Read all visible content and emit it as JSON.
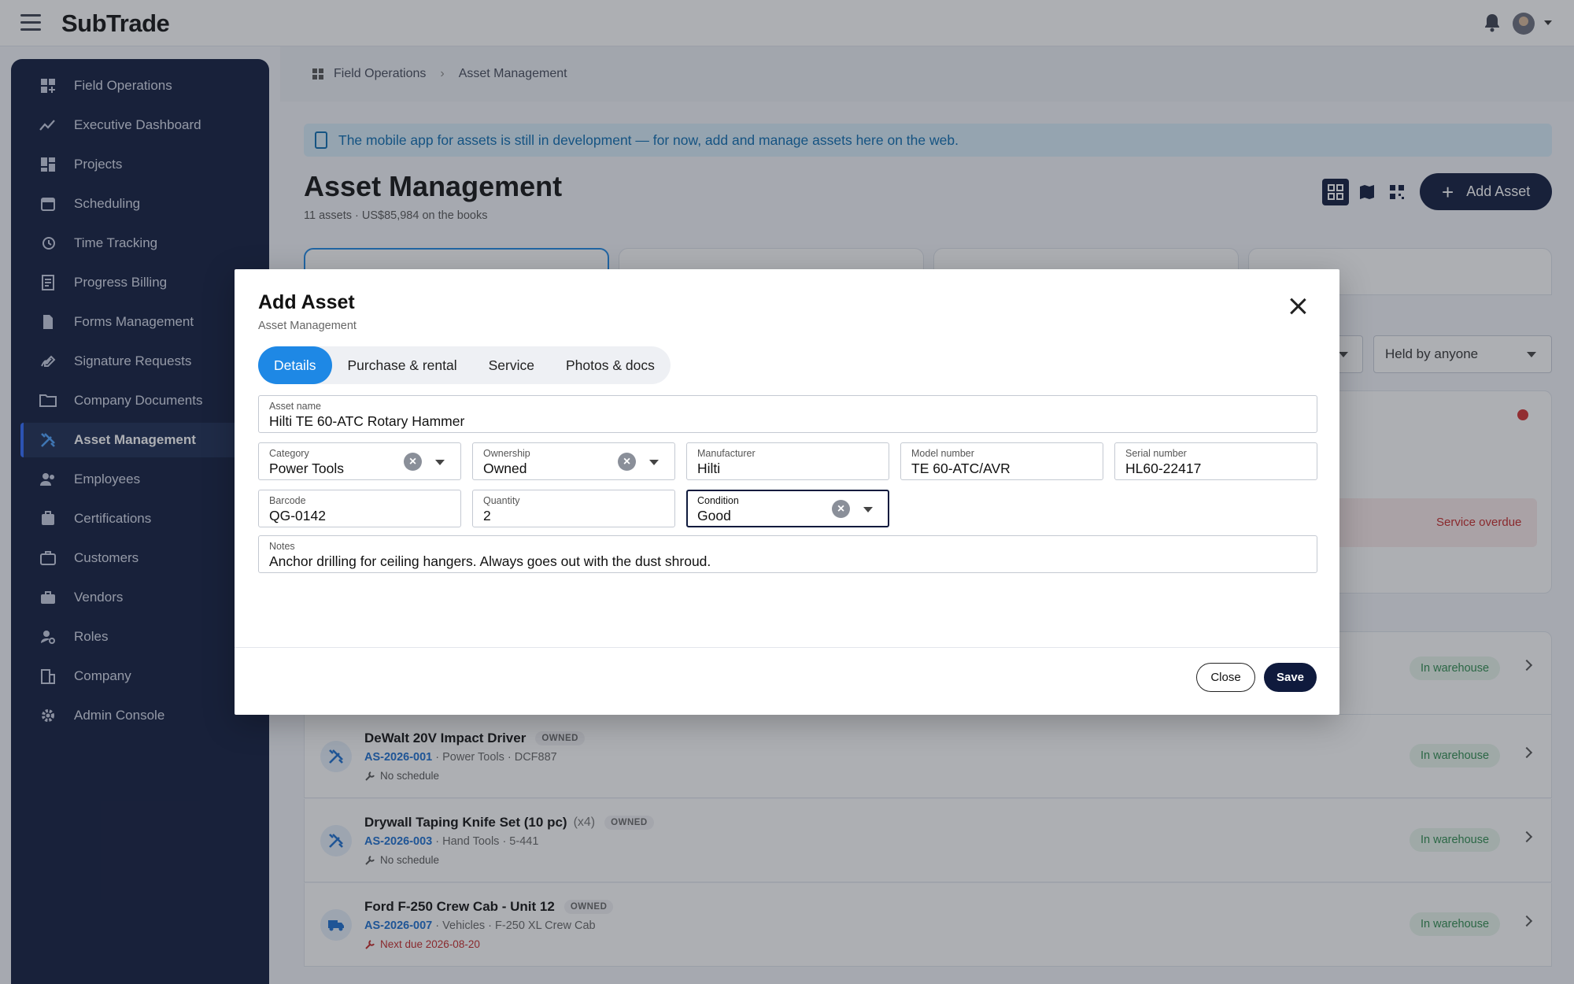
{
  "app": {
    "logo": "SubTrade"
  },
  "sidebar": {
    "items": [
      {
        "label": "Field Operations",
        "icon": "grid-plus-icon"
      },
      {
        "label": "Executive Dashboard",
        "icon": "trend-icon"
      },
      {
        "label": "Projects",
        "icon": "dashboard-icon"
      },
      {
        "label": "Scheduling",
        "icon": "calendar-icon"
      },
      {
        "label": "Time Tracking",
        "icon": "history-icon"
      },
      {
        "label": "Progress Billing",
        "icon": "receipt-icon"
      },
      {
        "label": "Forms Management",
        "icon": "document-icon"
      },
      {
        "label": "Signature Requests",
        "icon": "signature-icon"
      },
      {
        "label": "Company Documents",
        "icon": "folder-icon"
      },
      {
        "label": "Asset Management",
        "icon": "tools-icon",
        "active": true
      },
      {
        "label": "Employees",
        "icon": "people-icon"
      },
      {
        "label": "Certifications",
        "icon": "badge-icon"
      },
      {
        "label": "Customers",
        "icon": "briefcase-icon"
      },
      {
        "label": "Vendors",
        "icon": "toolbox-icon"
      },
      {
        "label": "Roles",
        "icon": "role-icon"
      },
      {
        "label": "Company",
        "icon": "building-icon"
      },
      {
        "label": "Admin Console",
        "icon": "gear-icon"
      }
    ]
  },
  "breadcrumb": {
    "root": "Field Operations",
    "current": "Asset Management"
  },
  "banner": {
    "text": "The mobile app for assets is still in development — for now, add and manage assets here on the web."
  },
  "page": {
    "title": "Asset Management",
    "subtitle": "11 assets · US$85,984 on the books",
    "add_button": "Add Asset"
  },
  "filters": {
    "held_by": "Held by anyone"
  },
  "background_alerts": {
    "service_overdue": "Service overdue"
  },
  "assets": [
    {
      "name": "DeWalt 20V Impact Driver",
      "qty": "",
      "badge": "OWNED",
      "code": "AS-2026-001",
      "meta": " · Power Tools · DCF887",
      "schedule": "No schedule",
      "overdue": false,
      "status": "In warehouse",
      "icon": "tools-icon"
    },
    {
      "name": "Drywall Taping Knife Set (10 pc)",
      "qty": "(x4)",
      "badge": "OWNED",
      "code": "AS-2026-003",
      "meta": " · Hand Tools · 5-441",
      "schedule": "No schedule",
      "overdue": false,
      "status": "In warehouse",
      "icon": "tools-icon"
    },
    {
      "name": "Ford F-250 Crew Cab - Unit 12",
      "qty": "",
      "badge": "OWNED",
      "code": "AS-2026-007",
      "meta": " · Vehicles · F-250 XL Crew Cab",
      "schedule": "Next due 2026-08-20",
      "overdue": true,
      "status": "In warehouse",
      "icon": "truck-icon"
    }
  ],
  "partial_row_status": "In warehouse",
  "modal": {
    "title": "Add Asset",
    "subtitle": "Asset Management",
    "tabs": [
      "Details",
      "Purchase & rental",
      "Service",
      "Photos & docs"
    ],
    "active_tab": "Details",
    "fields": {
      "asset_name": {
        "label": "Asset name",
        "value": "Hilti TE 60-ATC Rotary Hammer"
      },
      "category": {
        "label": "Category",
        "value": "Power Tools"
      },
      "ownership": {
        "label": "Ownership",
        "value": "Owned"
      },
      "manufacturer": {
        "label": "Manufacturer",
        "value": "Hilti"
      },
      "model_number": {
        "label": "Model number",
        "value": "TE 60-ATC/AVR"
      },
      "serial_number": {
        "label": "Serial number",
        "value": "HL60-22417"
      },
      "barcode": {
        "label": "Barcode",
        "value": "QG-0142"
      },
      "quantity": {
        "label": "Quantity",
        "value": "2"
      },
      "condition": {
        "label": "Condition",
        "value": "Good"
      },
      "notes": {
        "label": "Notes",
        "value": "Anchor drilling for ceiling hangers. Always goes out with the dust shroud."
      }
    },
    "close_label": "Close",
    "save_label": "Save"
  },
  "colors": {
    "navy": "#0f1a3d",
    "accent": "#1e88e5",
    "link": "#1a6fd1",
    "success": "#2e8b4e",
    "danger": "#c62828"
  }
}
